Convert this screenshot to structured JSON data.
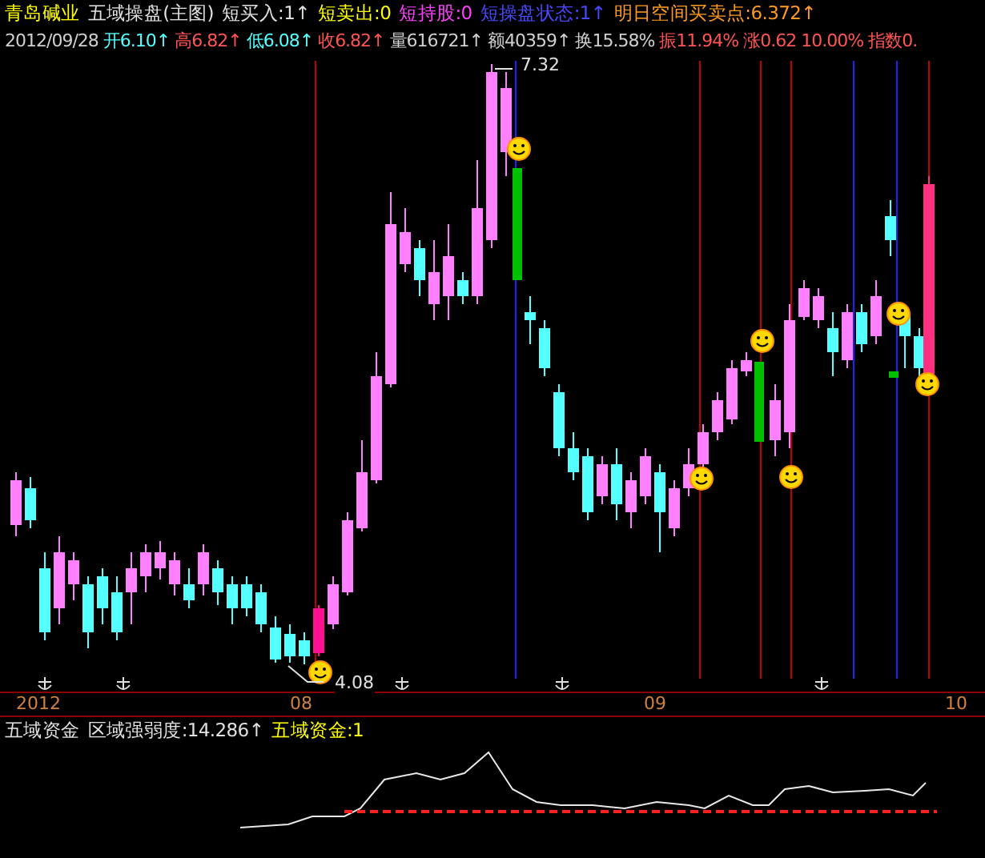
{
  "header": {
    "line1": [
      {
        "text": "青岛碱业",
        "color": "#ffff00"
      },
      {
        "text": "五域操盘(主图)",
        "color": "#e0e0e0"
      },
      {
        "text": "短买入:1↑",
        "color": "#e0e0e0"
      },
      {
        "text": "短卖出:0",
        "color": "#ffff00"
      },
      {
        "text": "短持股:0",
        "color": "#ff40ff"
      },
      {
        "text": "短操盘状态:1↑",
        "color": "#4848ff"
      },
      {
        "text": "明日空间买卖点:6.372↑",
        "color": "#ff9a20"
      }
    ],
    "line2": [
      {
        "text": "2012/09/28",
        "color": "#d0d0d0"
      },
      {
        "text": "开6.10↑",
        "color": "#54ffff"
      },
      {
        "text": "高6.82↑",
        "color": "#ff5454"
      },
      {
        "text": "低6.08↑",
        "color": "#54ffff"
      },
      {
        "text": "收6.82↑",
        "color": "#ff5454"
      },
      {
        "text": "量616721↑",
        "color": "#d0d0d0"
      },
      {
        "text": "额40359↑",
        "color": "#d0d0d0"
      },
      {
        "text": "换15.58%",
        "color": "#d0d0d0"
      },
      {
        "text": "振11.94%",
        "color": "#ff5454"
      },
      {
        "text": "涨0.62",
        "color": "#ff5454"
      },
      {
        "text": "10.00%",
        "color": "#ff5454"
      },
      {
        "text": "指数0.",
        "color": "#ff5454"
      }
    ]
  },
  "main_chart": {
    "high_label": "7.32",
    "low_label": "4.08"
  },
  "x_axis": [
    "2012",
    "08",
    "09",
    "10"
  ],
  "lower_panel": {
    "legend": [
      {
        "text": "五域资金",
        "color": "#e0e0e0"
      },
      {
        "text": "区域强弱度:14.286↑",
        "color": "#e0e0e0"
      },
      {
        "text": "五域资金:1",
        "color": "#ffff00"
      }
    ]
  }
}
